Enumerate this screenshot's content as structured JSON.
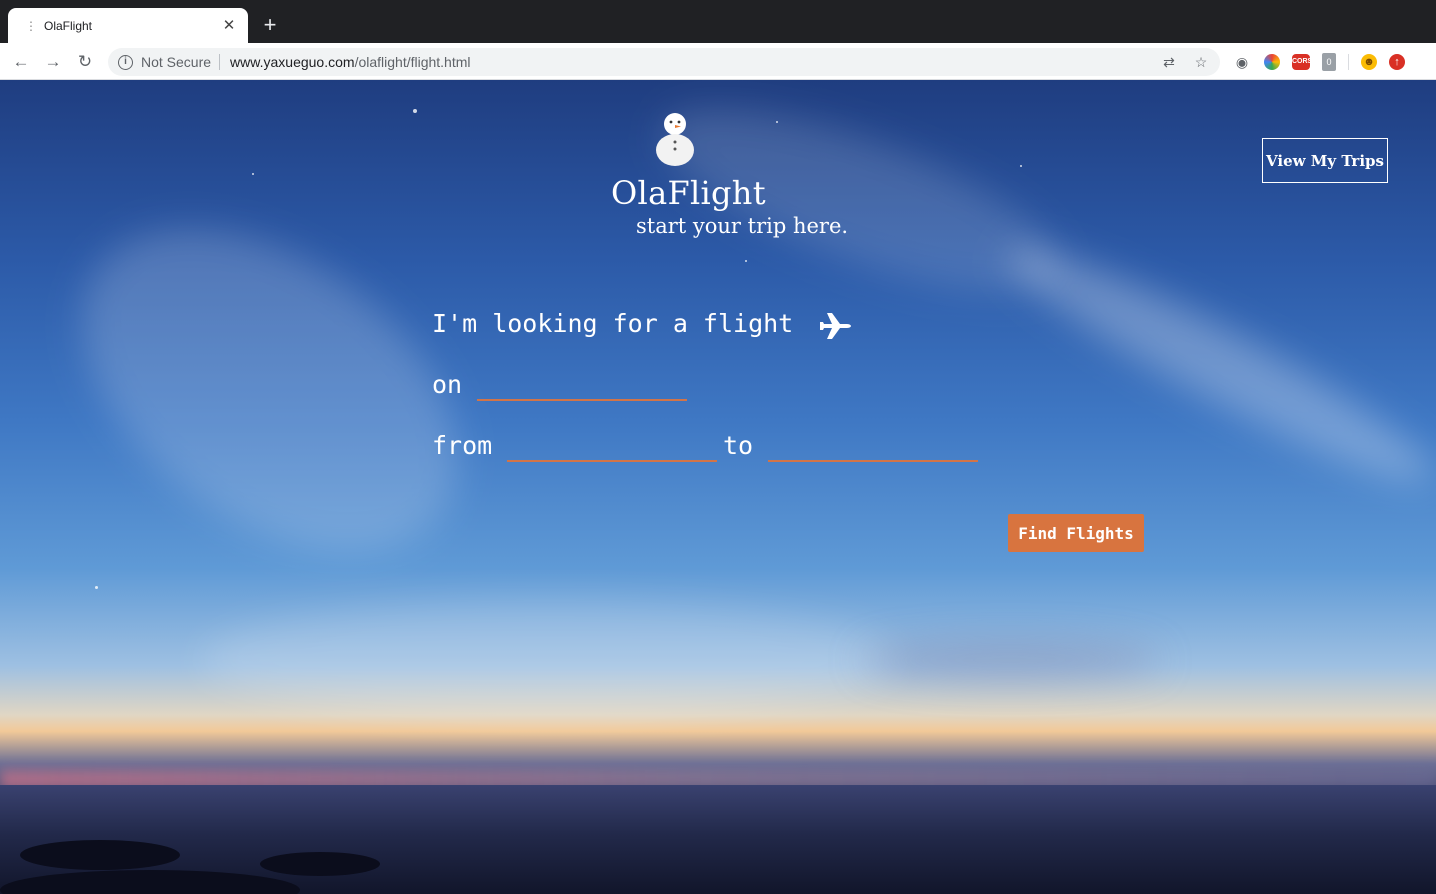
{
  "browser": {
    "tab_title": "OlaFlight",
    "security_label": "Not Secure",
    "url_host": "www.yaxueguo.com",
    "url_path": "/olaflight/flight.html",
    "extensions": [
      {
        "name": "screenshot-extension-icon",
        "label": "◉"
      },
      {
        "name": "color-wheel-extension-icon",
        "label": "●"
      },
      {
        "name": "cors-extension-icon",
        "label": "CORS"
      },
      {
        "name": "grey-extension-icon",
        "label": "0"
      },
      {
        "name": "emoji-extension-icon",
        "label": "☻"
      },
      {
        "name": "update-extension-icon",
        "label": "↑"
      }
    ]
  },
  "page": {
    "brand": "OlaFlight",
    "tagline": "start your trip here.",
    "view_trips_label": "View My Trips",
    "sentence_intro": "I'm looking for a flight",
    "on_label": "on",
    "from_label": "from",
    "to_label": "to",
    "date_value": "",
    "origin_value": "",
    "destination_value": "",
    "find_button_label": "Find Flights"
  },
  "colors": {
    "accent": "#d8743f",
    "input_underline": "#d27448"
  }
}
